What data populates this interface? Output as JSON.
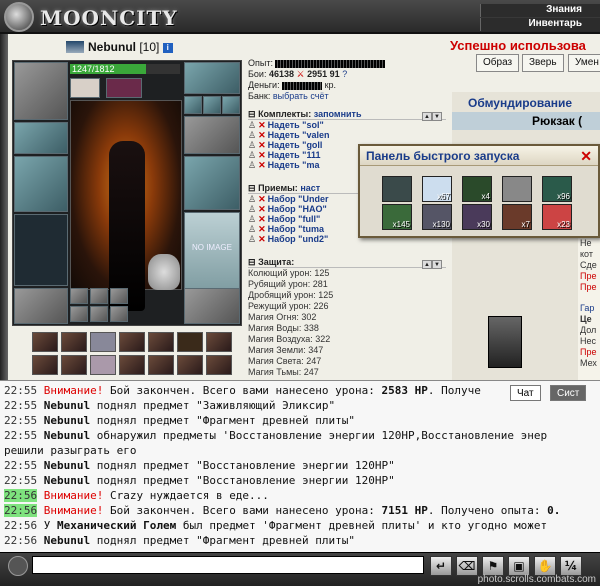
{
  "app": {
    "logo_text": "MOONCITY",
    "top_nav": [
      "Знания",
      "Инвентарь"
    ]
  },
  "character": {
    "name": "Nebunul",
    "level": "[10]",
    "info_icon": "i",
    "hp_text": "1247/1812",
    "hp_fraction": 0.69,
    "no_image_text": "NO IMAGE"
  },
  "stats": {
    "exp_label": "Опыт:",
    "battles_label": "Бои:",
    "battles_value": "46138",
    "battles_win": "2951",
    "battles_draw": "91",
    "money_label": "Деньги:",
    "money_suffix": "кр.",
    "bank_label": "Банк:",
    "bank_link": "выбрать счёт"
  },
  "sets": {
    "title": "Комплекты:",
    "remember_link": "запомнить",
    "items": [
      "Надеть \"sol\"",
      "Надеть \"valen",
      "Надеть \"goll",
      "Надеть \"111",
      "Надеть \"ma"
    ]
  },
  "techniques": {
    "title": "Приемы:",
    "setup_link": "наст",
    "items": [
      "Набор \"Under",
      "Набор \"HAO\"",
      "Набор \"full\"",
      "Набор \"tuma",
      "Набор \"und2\""
    ]
  },
  "protection": {
    "title": "Защита:",
    "rows": [
      "Колющий урон: 125",
      "Рубящий урон: 281",
      "Дробящий урон: 125",
      "Режущий урон: 226",
      "Магия Огня: 302",
      "Магия Воды: 338",
      "Магия Воздуха: 322",
      "Магия Земли: 347",
      "Магия Света: 247",
      "Магия Тьмы: 247"
    ]
  },
  "right": {
    "success_text": "Успешно использова",
    "buttons": [
      "Образ",
      "Зверь",
      "Умен"
    ],
    "equip_title": "Обмундирование",
    "backpack_title": "Рюкзак (",
    "side_text": [
      "Не",
      "кот",
      "Сде",
      "Пре",
      "Пре",
      "Гар",
      "Це",
      "Дол",
      "Нес",
      "Пре",
      "Мех"
    ]
  },
  "quick_panel": {
    "title": "Панель быстрого запуска",
    "close": "✕",
    "slots": [
      {
        "count": ""
      },
      {
        "count": "x67"
      },
      {
        "count": "x4"
      },
      {
        "count": ""
      },
      {
        "count": "x96"
      },
      {
        "count": "x145"
      },
      {
        "count": "x130"
      },
      {
        "count": "x30"
      },
      {
        "count": "x7"
      },
      {
        "count": "x23"
      }
    ]
  },
  "chat": {
    "tabs": [
      "Чат",
      "Сист"
    ],
    "lines": [
      {
        "time": "22:55",
        "parts": [
          {
            "c": "w",
            "t": "Внимание!"
          },
          {
            "c": "",
            "t": " Бой закончен. Всего вами нанесено урона: "
          },
          {
            "c": "b",
            "t": "2583 HP"
          },
          {
            "c": "",
            "t": ". Получе"
          }
        ],
        "green": false
      },
      {
        "time": "22:55",
        "parts": [
          {
            "c": "b",
            "t": "Nebunul"
          },
          {
            "c": "",
            "t": " поднял предмет \"Заживляющий Эликсир\""
          }
        ],
        "green": false
      },
      {
        "time": "22:55",
        "parts": [
          {
            "c": "b",
            "t": "Nebunul"
          },
          {
            "c": "",
            "t": " поднял предмет \"Фрагмент древней плиты\""
          }
        ],
        "green": false
      },
      {
        "time": "22:55",
        "parts": [
          {
            "c": "b",
            "t": "Nebunul"
          },
          {
            "c": "",
            "t": " обнаружил предметы 'Восстановление энергии 120HP,Восстановление энер"
          }
        ],
        "green": false
      },
      {
        "time": "",
        "parts": [
          {
            "c": "",
            "t": "решили разыграть его"
          }
        ],
        "green": false
      },
      {
        "time": "22:55",
        "parts": [
          {
            "c": "b",
            "t": "Nebunul"
          },
          {
            "c": "",
            "t": " поднял предмет \"Восстановление энергии 120HP\""
          }
        ],
        "green": false
      },
      {
        "time": "22:55",
        "parts": [
          {
            "c": "b",
            "t": "Nebunul"
          },
          {
            "c": "",
            "t": " поднял предмет \"Восстановление энергии 120HP\""
          }
        ],
        "green": false
      },
      {
        "time": "22:56",
        "parts": [
          {
            "c": "w",
            "t": "Внимание!"
          },
          {
            "c": "",
            "t": " Crazy нуждается в еде..."
          }
        ],
        "green": true
      },
      {
        "time": "22:56",
        "parts": [
          {
            "c": "w",
            "t": "Внимание!"
          },
          {
            "c": "",
            "t": " Бой закончен. Всего вами нанесено урона: "
          },
          {
            "c": "b",
            "t": "7151 HP"
          },
          {
            "c": "",
            "t": ". Получено опыта: "
          },
          {
            "c": "b",
            "t": "0."
          }
        ],
        "green": true
      },
      {
        "time": "22:56",
        "parts": [
          {
            "c": "",
            "t": "У "
          },
          {
            "c": "b",
            "t": "Механический Голем"
          },
          {
            "c": "",
            "t": " был предмет 'Фрагмент древней плиты' и кто угодно может"
          }
        ],
        "green": false
      },
      {
        "time": "22:56",
        "parts": [
          {
            "c": "b",
            "t": "Nebunul"
          },
          {
            "c": "",
            "t": " поднял предмет \"Фрагмент древней плиты\""
          }
        ],
        "green": false
      }
    ]
  },
  "watermark": "photo.scrolls.combats.com"
}
